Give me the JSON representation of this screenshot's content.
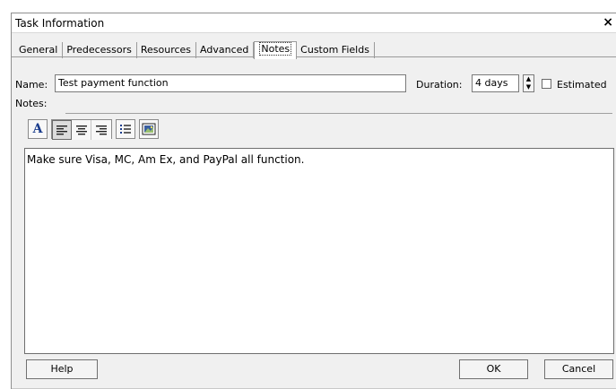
{
  "window": {
    "title": "Task Information",
    "close_glyph": "×"
  },
  "tabs": [
    {
      "label": "General"
    },
    {
      "label": "Predecessors"
    },
    {
      "label": "Resources"
    },
    {
      "label": "Advanced"
    },
    {
      "label": "Notes",
      "active": true
    },
    {
      "label": "Custom Fields"
    }
  ],
  "fields": {
    "name_label": "Name:",
    "name_value": "Test payment function",
    "duration_label": "Duration:",
    "duration_value": "4 days",
    "estimated_label": "Estimated",
    "estimated_checked": false
  },
  "notes": {
    "label": "Notes:",
    "text": "Make sure Visa, MC, Am Ex, and PayPal all function."
  },
  "toolbar": {
    "icons": [
      "font-icon",
      "align-left-icon",
      "align-center-icon",
      "align-right-icon",
      "bullet-list-icon",
      "insert-object-icon"
    ]
  },
  "buttons": {
    "help": "Help",
    "ok": "OK",
    "cancel": "Cancel"
  }
}
